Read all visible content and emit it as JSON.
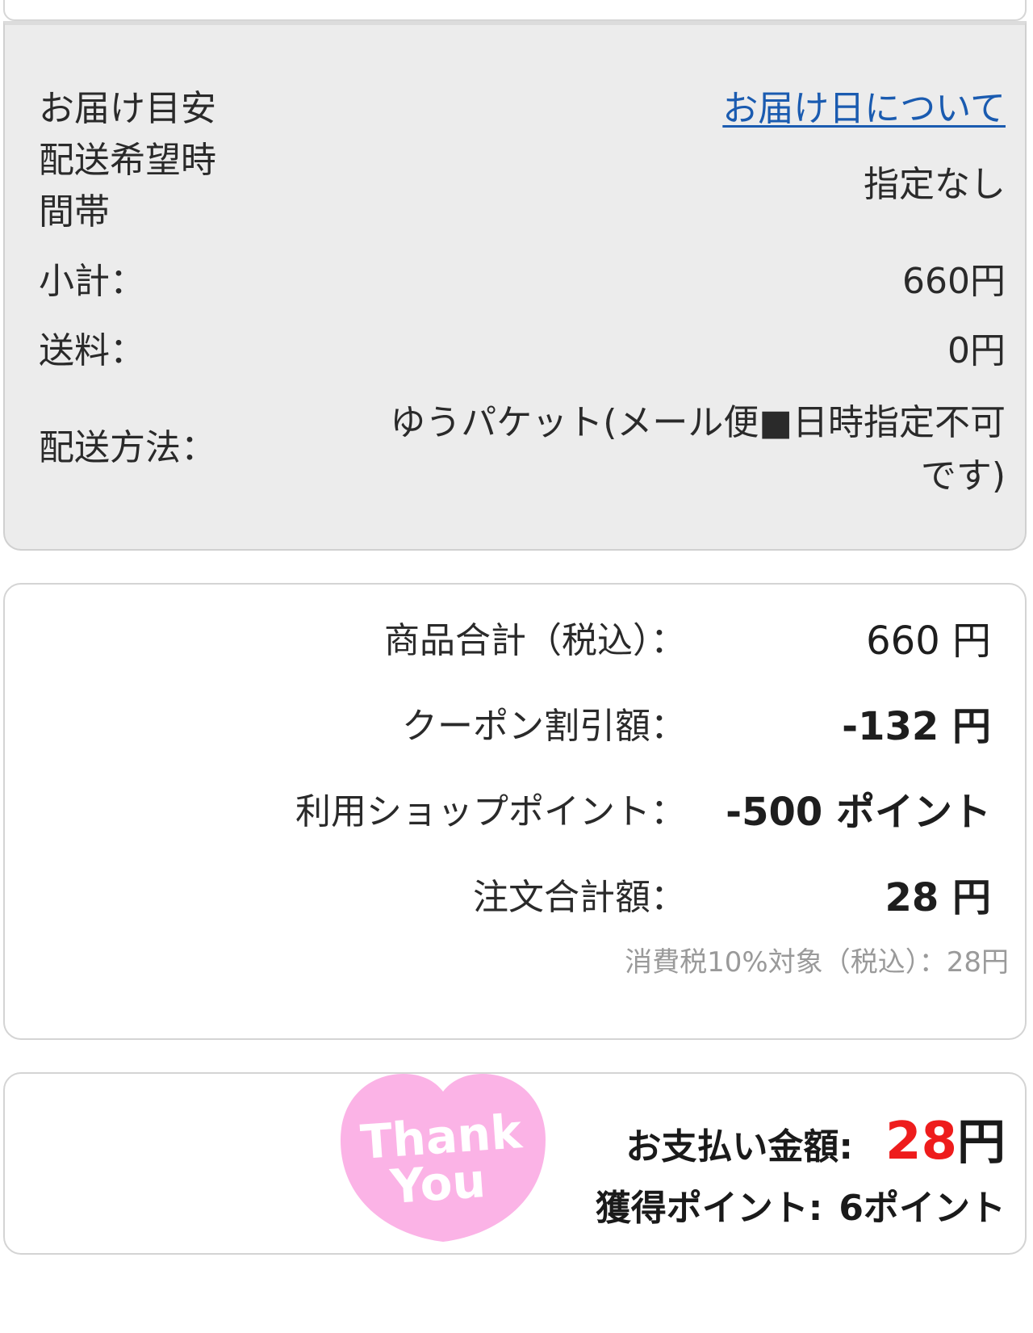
{
  "delivery": {
    "estimate_label": "お届け目安",
    "estimate_link": "お届け日について",
    "time_slot_label_line1": "配送希望時",
    "time_slot_label_line2": "間帯",
    "time_slot_value": "指定なし",
    "subtotal_label": "小計：",
    "subtotal_value": "660円",
    "shipping_label": "送料：",
    "shipping_value": "0円",
    "method_label": "配送方法：",
    "method_value": "ゆうパケット(メール便■日時指定不可です)"
  },
  "totals": {
    "rows": [
      {
        "label": "商品合計（税込）：",
        "value": "660 円"
      },
      {
        "label": "クーポン割引額：",
        "value": "-132 円"
      },
      {
        "label": "利用ショップポイント：",
        "value": "-500 ポイント"
      },
      {
        "label": "注文合計額：",
        "value": "28 円"
      }
    ],
    "tax_note": "消費税10%対象（税込）：28円"
  },
  "payment": {
    "thank_you_line1": "Thank",
    "thank_you_line2": "You",
    "amount_label": "お支払い金額:",
    "amount_value": "28",
    "amount_unit": "円",
    "points_label": "獲得ポイント:",
    "points_value": "6ポイント",
    "heart_color": "#fbb3e6",
    "amount_color": "#ee1c1c",
    "link_color": "#1a5bb0"
  }
}
